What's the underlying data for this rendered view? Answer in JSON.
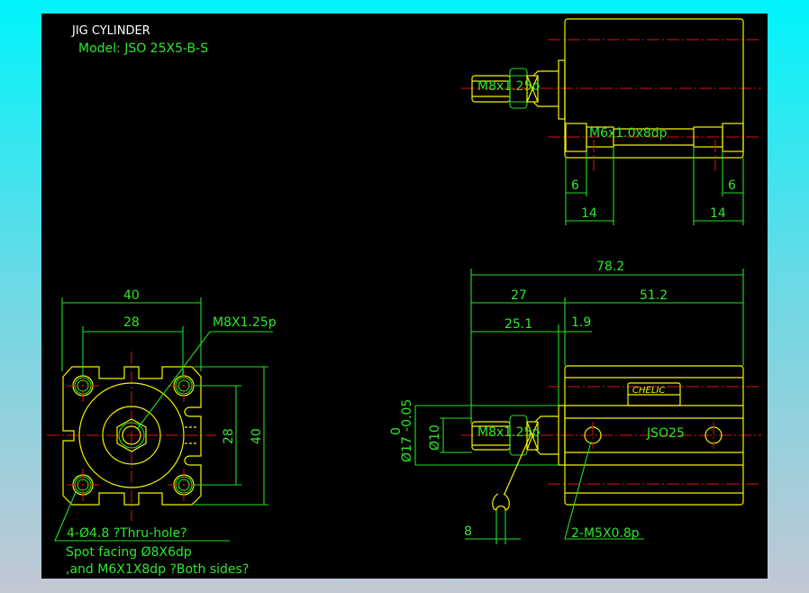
{
  "title": "JIG CYLINDER",
  "model": "Model:  JSO 25X5-B-S",
  "colors": {
    "background": "#000000",
    "outline": "#f3f300",
    "dimension": "#22e022",
    "centerline": "#e01010"
  },
  "top_view": {
    "rod_thread": "M8x1.25p",
    "port_thread": "M6x1.0x8dp",
    "dims": [
      "6",
      "14",
      "6",
      "14"
    ]
  },
  "side_view": {
    "dims": {
      "overall": "78.2",
      "rod_side": "27",
      "body": "51.2",
      "rod_ext": "25.1",
      "flange": "1.9",
      "flange_dia": "Ø17",
      "tol_upper": "0",
      "tol_lower": "-0.05",
      "rod_dia": "Ø10",
      "wrench": "8"
    },
    "rod_thread": "M8x1.25p",
    "brand": "CHELIC",
    "body_label": "JSO25",
    "port_note": "2-M5X0.8p"
  },
  "front_view": {
    "dims": [
      "40",
      "28",
      "28",
      "40"
    ],
    "rod_thread_note": "M8X1.25p"
  },
  "notes": [
    "4-Ø4.8 ?Thru-hole?",
    "Spot facing  Ø8X6dp",
    ",and M6X1X8dp ?Both sides?"
  ]
}
